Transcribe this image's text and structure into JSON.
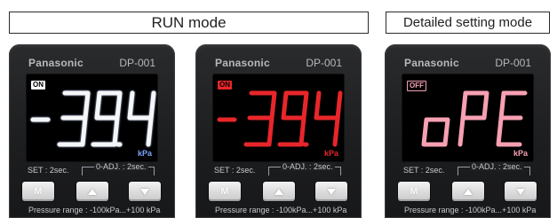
{
  "headers": {
    "run_mode": "RUN mode",
    "detailed_mode": "Detailed setting mode"
  },
  "colors": {
    "white_digits": "#f4f6f8",
    "red_digits": "#e8262a",
    "pink_digits": "#f6a0b2",
    "blue_unit": "#7da4ff"
  },
  "devices": [
    {
      "brand": "Panasonic",
      "model": "DP-001",
      "badge": "ON",
      "display": "- 39.4",
      "unit": "kPa",
      "set_label": "SET : 2sec.",
      "adj_label": "0-ADJ. : 2sec.",
      "btn_m": "M",
      "up_icon": "up-triangle-icon",
      "down_icon": "down-triangle-icon",
      "pressure_range": "Pressure range : -100kPa...+100 kPa",
      "digit_color": "white"
    },
    {
      "brand": "Panasonic",
      "model": "DP-001",
      "badge": "ON",
      "display": "- 39.4",
      "unit": "kPa",
      "set_label": "SET : 2sec.",
      "adj_label": "0-ADJ. : 2sec.",
      "btn_m": "M",
      "up_icon": "up-triangle-icon",
      "down_icon": "down-triangle-icon",
      "pressure_range": "Pressure range : -100kPa...+100 kPa",
      "digit_color": "red"
    },
    {
      "brand": "Panasonic",
      "model": "DP-001",
      "badge": "OFF",
      "display": "oPE",
      "unit": "kPa",
      "set_label": "SET : 2sec.",
      "adj_label": "0-ADJ. : 2sec.",
      "btn_m": "M",
      "up_icon": "up-triangle-icon",
      "down_icon": "down-triangle-icon",
      "pressure_range": "Pressure range : -100kPa...+100 kPa",
      "digit_color": "pink"
    }
  ]
}
